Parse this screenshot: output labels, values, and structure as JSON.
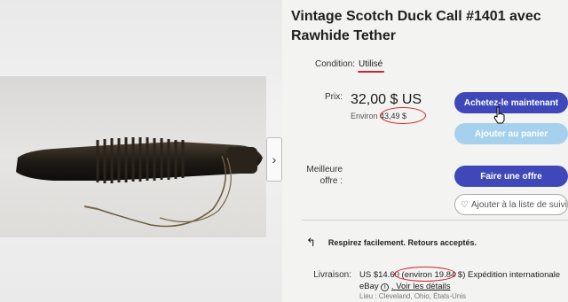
{
  "listing": {
    "title": "Vintage Scotch Duck Call #1401 avec Rawhide Tether",
    "next_arrow": "›"
  },
  "condition": {
    "label": "Condition:",
    "value": "Utilisé"
  },
  "price": {
    "label": "Prix:",
    "value": "32,00 $ US",
    "approx_prefix": "Environ",
    "approx_value": "43,49 $"
  },
  "best_offer": {
    "label_line1": "Meilleure",
    "label_line2": "offre :"
  },
  "buttons": {
    "buy_now": "Achetez-le maintenant",
    "add_to_cart": "Ajouter au panier",
    "make_offer": "Faire une offre",
    "watchlist": "Ajouter à la liste de suivi"
  },
  "returns": {
    "text": "Respirez facilement. Retours acceptés."
  },
  "shipping": {
    "label": "Livraison:",
    "amount": "US $14.60",
    "approx": "(environ 19.84 $)",
    "method": "Expédition internationale",
    "carrier": "eBay",
    "details_link": ". Voir les détails",
    "location": "Lieu : Cleveland, Ohio, États-Unis"
  },
  "colors": {
    "primary_button": "#3f48b8",
    "secondary_button": "#a6d1ee",
    "annotation_red": "#d4202f"
  }
}
